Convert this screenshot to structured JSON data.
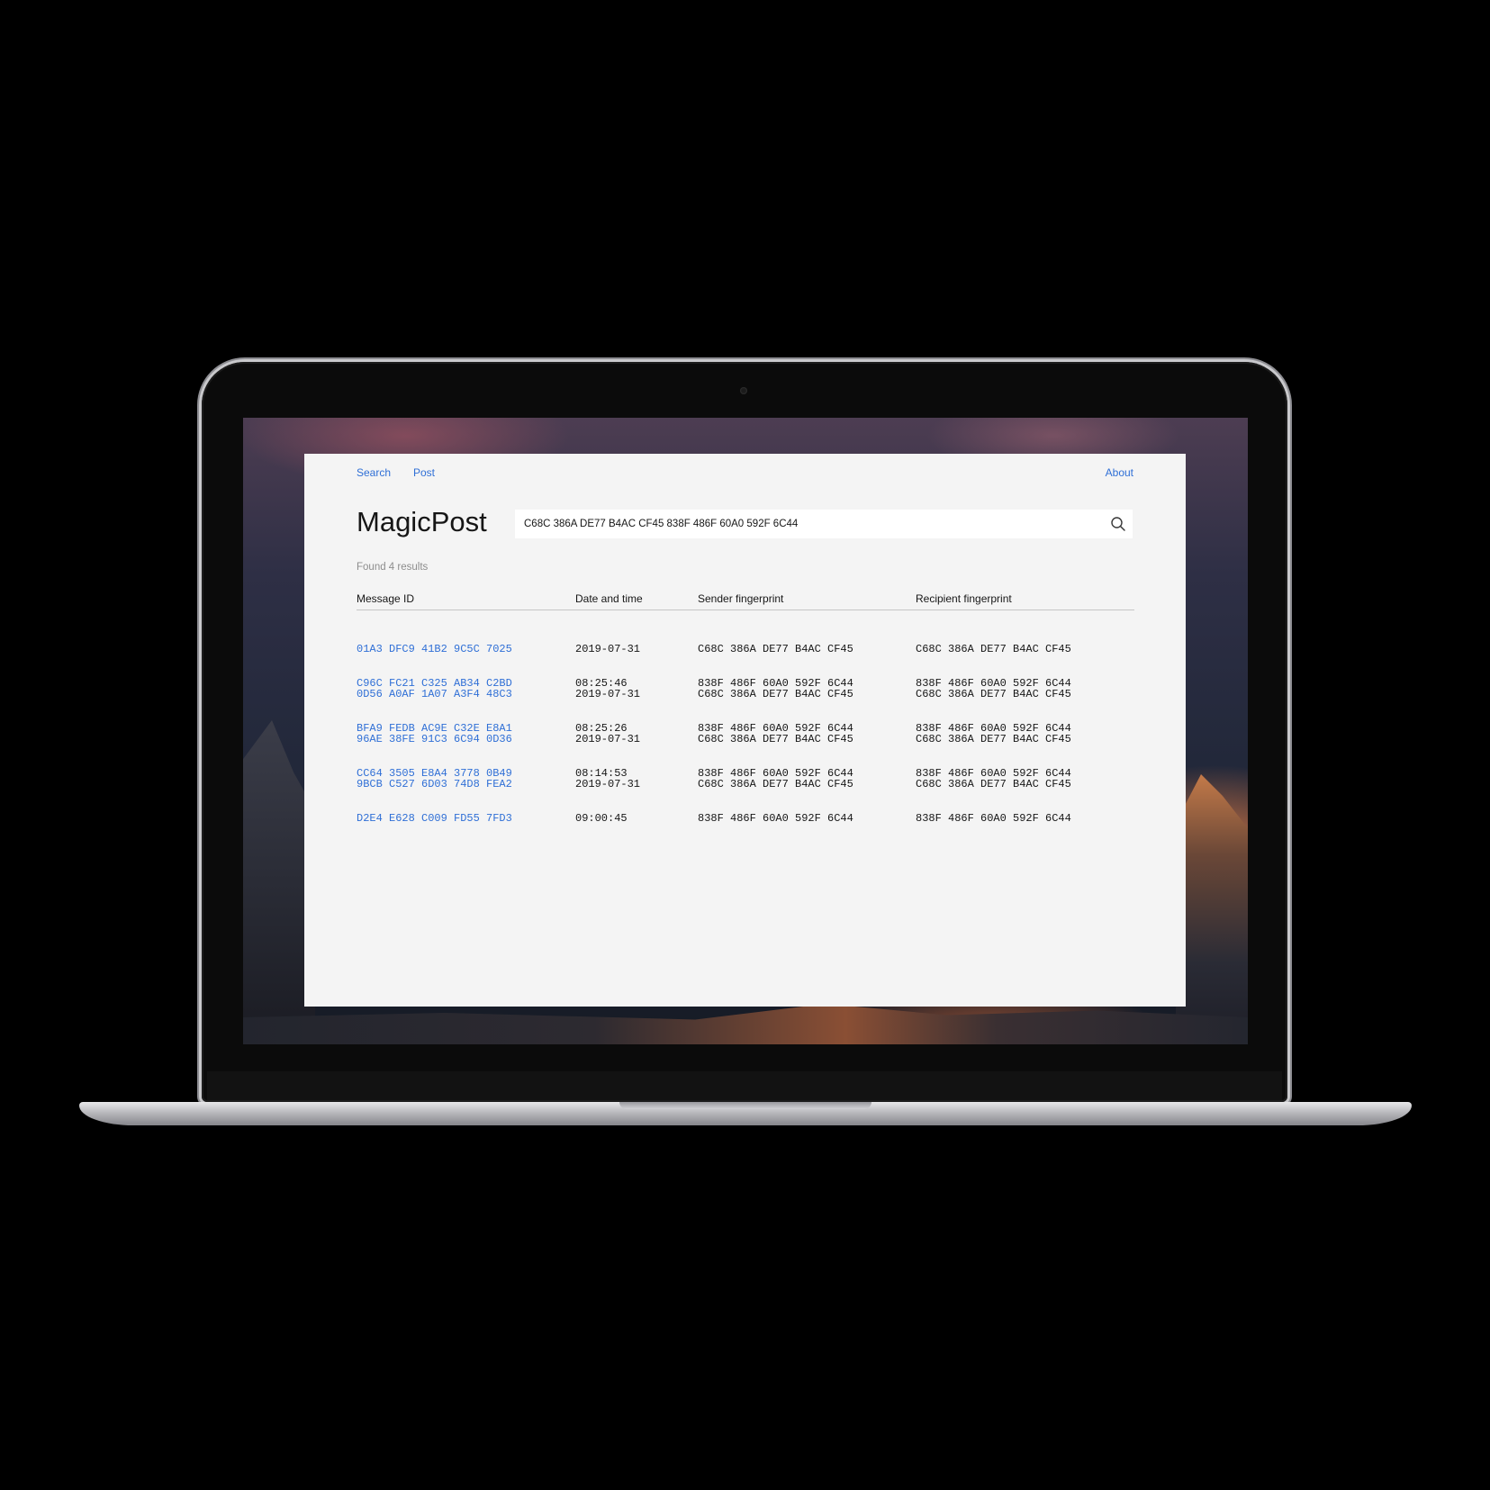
{
  "nav": {
    "search": "Search",
    "post": "Post",
    "about": "About"
  },
  "app": {
    "title": "MagicPost"
  },
  "search": {
    "value": "C68C 386A DE77 B4AC CF45 838F 486F 60A0 592F 6C44"
  },
  "results": {
    "summary": "Found 4 results",
    "columns": [
      "Message ID",
      "Date and time",
      "Sender fingerprint",
      "Recipient fingerprint"
    ],
    "rows": [
      {
        "id": [
          "01A3 DFC9 41B2 9C5C 7025",
          "C96C FC21 C325 AB34 C2BD"
        ],
        "datetime": [
          "2019-07-31",
          "08:25:46"
        ],
        "sender": [
          "C68C 386A DE77 B4AC CF45",
          "838F 486F 60A0 592F 6C44"
        ],
        "recipient": [
          "C68C 386A DE77 B4AC CF45",
          "838F 486F 60A0 592F 6C44"
        ]
      },
      {
        "id": [
          "0D56 A0AF 1A07 A3F4 48C3",
          "BFA9 FEDB AC9E C32E E8A1"
        ],
        "datetime": [
          "2019-07-31",
          "08:25:26"
        ],
        "sender": [
          "C68C 386A DE77 B4AC CF45",
          "838F 486F 60A0 592F 6C44"
        ],
        "recipient": [
          "C68C 386A DE77 B4AC CF45",
          "838F 486F 60A0 592F 6C44"
        ]
      },
      {
        "id": [
          "96AE 38FE 91C3 6C94 0D36",
          "CC64 3505 E8A4 3778 0B49"
        ],
        "datetime": [
          "2019-07-31",
          "08:14:53"
        ],
        "sender": [
          "C68C 386A DE77 B4AC CF45",
          "838F 486F 60A0 592F 6C44"
        ],
        "recipient": [
          "C68C 386A DE77 B4AC CF45",
          "838F 486F 60A0 592F 6C44"
        ]
      },
      {
        "id": [
          "9BCB C527 6D03 74D8 FEA2",
          "D2E4 E628 C009 FD55 7FD3"
        ],
        "datetime": [
          "2019-07-31",
          "09:00:45"
        ],
        "sender": [
          "C68C 386A DE77 B4AC CF45",
          "838F 486F 60A0 592F 6C44"
        ],
        "recipient": [
          "C68C 386A DE77 B4AC CF45",
          "838F 486F 60A0 592F 6C44"
        ]
      }
    ]
  },
  "icons": {
    "search": "search-icon"
  },
  "colors": {
    "link": "#2f6fd6",
    "muted": "#8d8d8d",
    "panel": "#f4f4f4"
  }
}
